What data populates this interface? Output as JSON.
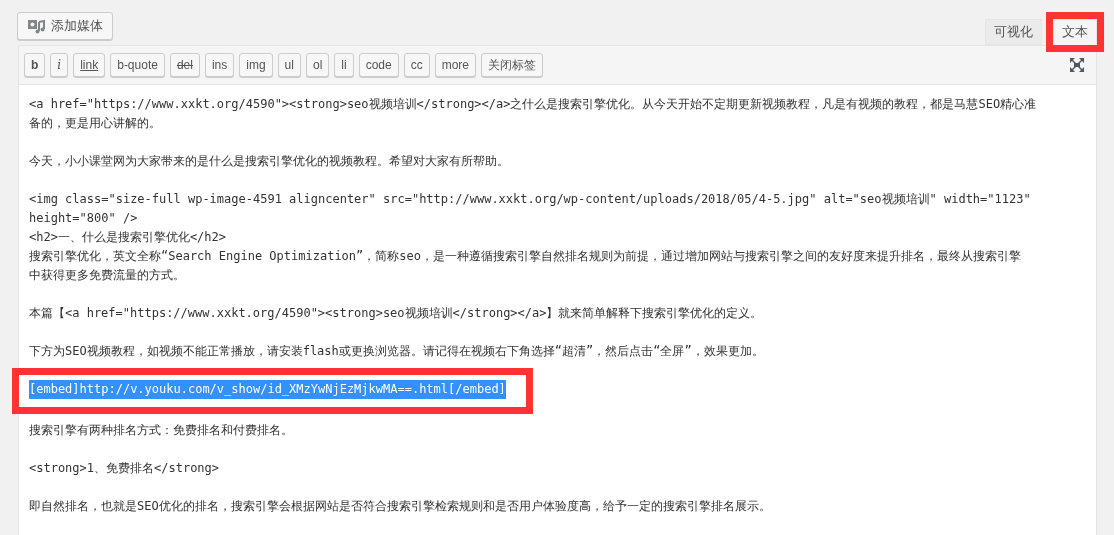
{
  "add_media": {
    "label": "添加媒体"
  },
  "tabs": [
    {
      "label": "可视化",
      "selected": false,
      "highlighted": false
    },
    {
      "label": "文本",
      "selected": true,
      "highlighted": true
    }
  ],
  "toolbar": [
    {
      "label": "b",
      "kind": "bold"
    },
    {
      "label": "i",
      "kind": "italic"
    },
    {
      "label": "link",
      "kind": "underline"
    },
    {
      "label": "b-quote",
      "kind": "plain"
    },
    {
      "label": "del",
      "kind": "strike"
    },
    {
      "label": "ins",
      "kind": "plain"
    },
    {
      "label": "img",
      "kind": "plain"
    },
    {
      "label": "ul",
      "kind": "plain"
    },
    {
      "label": "ol",
      "kind": "plain"
    },
    {
      "label": "li",
      "kind": "plain"
    },
    {
      "label": "code",
      "kind": "plain"
    },
    {
      "label": "cc",
      "kind": "plain"
    },
    {
      "label": "more",
      "kind": "plain"
    },
    {
      "label": "关闭标签",
      "kind": "plain"
    }
  ],
  "paragraphs": [
    {
      "lines": [
        "<a href=\"https://www.xxkt.org/4590\"><strong>seo视频培训</strong></a>之什么是搜索引擎优化。从今天开始不定期更新视频教程，凡是有视频的教程，都是马慧SEO精心准",
        "备的，更是用心讲解的。"
      ],
      "selected": false,
      "highlighted": false
    },
    {
      "lines": [
        "今天，小小课堂网为大家带来的是什么是搜索引擎优化的视频教程。希望对大家有所帮助。"
      ],
      "selected": false,
      "highlighted": false
    },
    {
      "lines": [
        "<img class=\"size-full wp-image-4591 aligncenter\" src=\"http://www.xxkt.org/wp-content/uploads/2018/05/4-5.jpg\" alt=\"seo视频培训\" width=\"1123\"",
        "height=\"800\" />",
        "<h2>一、什么是搜索引擎优化</h2>",
        "搜索引擎优化，英文全称“Search Engine Optimization”，简称seo，是一种遵循搜索引擎自然排名规则为前提，通过增加网站与搜索引擎之间的友好度来提升排名，最终从搜索引擎",
        "中获得更多免费流量的方式。"
      ],
      "selected": false,
      "highlighted": false
    },
    {
      "lines": [
        "本篇【<a href=\"https://www.xxkt.org/4590\"><strong>seo视频培训</strong></a>】就来简单解释下搜索引擎优化的定义。"
      ],
      "selected": false,
      "highlighted": false
    },
    {
      "lines": [
        "下方为SEO视频教程，如视频不能正常播放，请安装flash或更换浏览器。请记得在视频右下角选择“超清”，然后点击“全屏”，效果更加。"
      ],
      "selected": false,
      "highlighted": false
    },
    {
      "lines": [
        "[embed]http://v.youku.com/v_show/id_XMzYwNjEzMjkwMA==.html[/embed]"
      ],
      "selected": true,
      "highlighted": true
    },
    {
      "lines": [
        "搜索引擎有两种排名方式：免费排名和付费排名。"
      ],
      "selected": false,
      "highlighted": false
    },
    {
      "lines": [
        "<strong>1、免费排名</strong>"
      ],
      "selected": false,
      "highlighted": false
    },
    {
      "lines": [
        "即自然排名，也就是SEO优化的排名，搜索引擎会根据网站是否符合搜索引擎检索规则和是否用户体验度高，给予一定的搜索引擎排名展示。"
      ],
      "selected": false,
      "highlighted": false
    }
  ]
}
